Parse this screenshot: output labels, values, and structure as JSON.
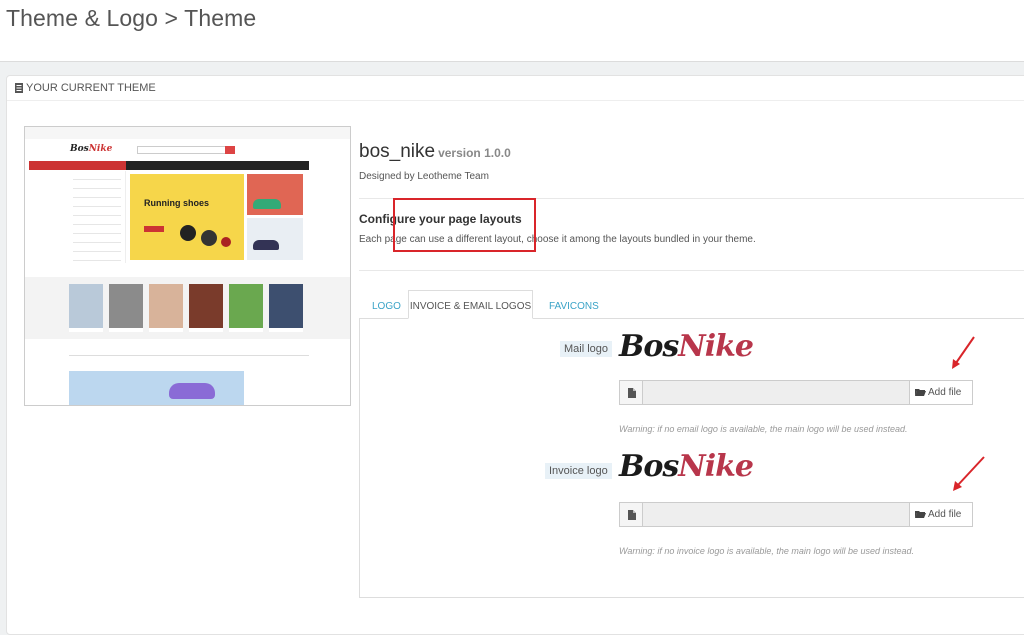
{
  "header": {
    "title": "Theme & Logo > Theme"
  },
  "panel": {
    "heading": "YOUR CURRENT THEME"
  },
  "thumbnail": {
    "logo_a": "Bos",
    "logo_b": "Nike",
    "hero_text": "Running shoes"
  },
  "theme": {
    "name": "bos_nike",
    "version": "version 1.0.0",
    "designed_by": "Designed by Leotheme Team"
  },
  "layouts": {
    "title": "Configure your page layouts",
    "description": "Each page can use a different layout, choose it among the layouts bundled in your theme."
  },
  "tabs": [
    {
      "label": "LOGO"
    },
    {
      "label": "INVOICE & EMAIL LOGOS"
    },
    {
      "label": "FAVICONS"
    }
  ],
  "mail": {
    "label": "Mail logo",
    "logo_a": "Bos",
    "logo_b": "Nike",
    "button": "Add file",
    "warning": "Warning: if no email logo is available, the main logo will be used instead."
  },
  "invoice": {
    "label": "Invoice logo",
    "logo_a": "Bos",
    "logo_b": "Nike",
    "button": "Add file",
    "warning": "Warning: if no invoice logo is available, the main logo will be used instead."
  },
  "colors": {
    "accent_tab": "#3aa3c7",
    "highlight": "#d9252a",
    "brand_red": "#b8364b"
  }
}
